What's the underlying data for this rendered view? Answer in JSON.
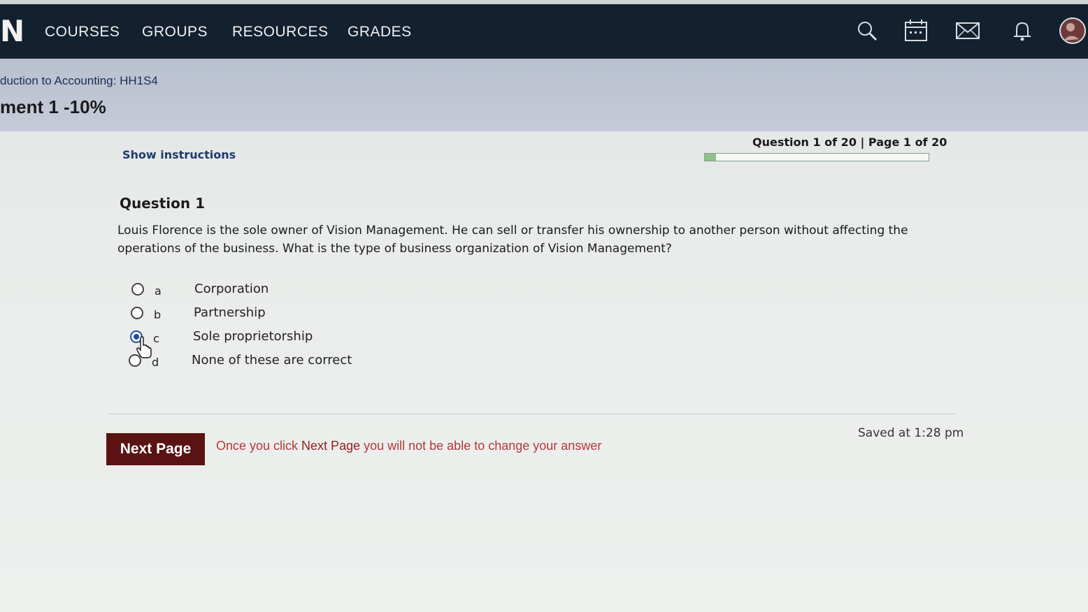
{
  "nav": {
    "logo": "N",
    "items": [
      {
        "label": "COURSES"
      },
      {
        "label": "GROUPS"
      },
      {
        "label": "RESOURCES"
      },
      {
        "label": "GRADES"
      }
    ],
    "icons": [
      "search-icon",
      "calendar-icon",
      "mail-icon",
      "notification-bell-icon",
      "user-avatar"
    ]
  },
  "header": {
    "course": "duction to Accounting: HH1S4",
    "assignment": "ment 1 -10%"
  },
  "quiz": {
    "show_instructions": "Show instructions",
    "counter": "Question 1 of 20 | Page 1 of 20",
    "progress_fraction": 0.05,
    "question_title": "Question 1",
    "question_text": "Louis Florence is the sole owner of Vision Management. He can sell or transfer his ownership to another person without affecting the operations of the business. What is the type of business organization of Vision Management?",
    "options": [
      {
        "letter": "a",
        "label": "Corporation",
        "selected": false
      },
      {
        "letter": "b",
        "label": "Partnership",
        "selected": false
      },
      {
        "letter": "c",
        "label": "Sole proprietorship",
        "selected": true
      },
      {
        "letter": "d",
        "label": "None of these are correct",
        "selected": false
      }
    ]
  },
  "footer": {
    "next_button": "Next Page",
    "warning_prefix": "Once you click ",
    "warning_emphasis": "Next Page",
    "warning_suffix": " you will not be able to change your answer",
    "saved": "Saved at 1:28 pm"
  },
  "colors": {
    "topbar": "#13212e",
    "header_band": "#c5cbd6",
    "button": "#5a1212",
    "warning": "#b23a3a",
    "radio_selected": "#1f4ba6",
    "progress_fill": "#8fc08a"
  }
}
